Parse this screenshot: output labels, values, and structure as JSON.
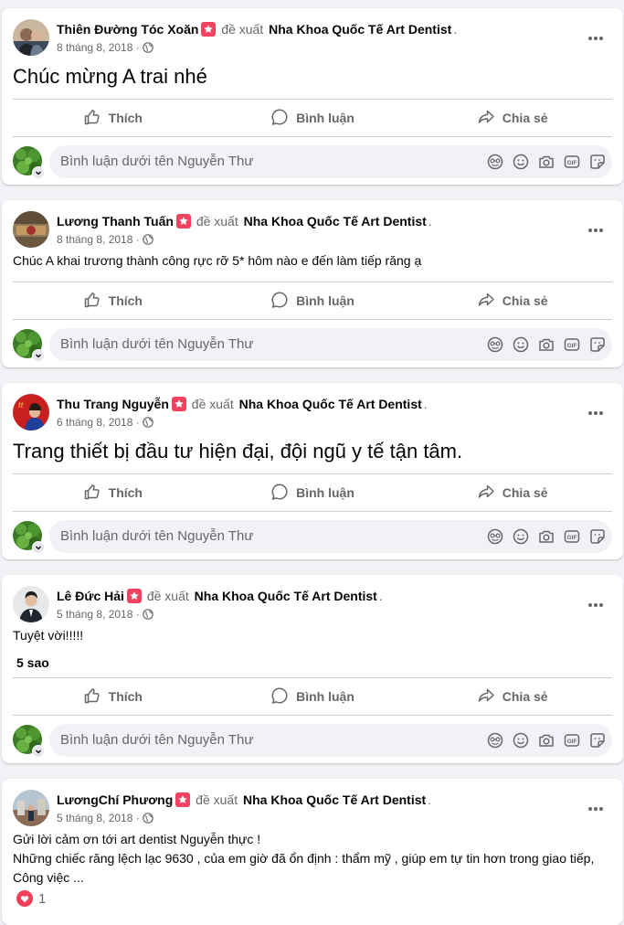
{
  "colors": {
    "accent": "#f3425f",
    "secondary_text": "#65676b",
    "background": "#f0f2f5"
  },
  "comment_placeholder": "Bình luận dưới tên Nguyễn Thư",
  "actions": {
    "like": "Thích",
    "comment": "Bình luận",
    "share": "Chia sẻ"
  },
  "posts": [
    {
      "author": "Thiên Đường Tóc Xoăn",
      "verb": "đề xuất",
      "page": "Nha Khoa Quốc Tế Art Dentist",
      "period": ".",
      "date": "8 tháng 8, 2018",
      "text": "Chúc mừng A trai nhé"
    },
    {
      "author": "Lương Thanh Tuấn",
      "verb": "đề xuất",
      "page": "Nha Khoa Quốc Tế Art Dentist",
      "period": ".",
      "date": "8 tháng 8, 2018",
      "text": "Chúc A khai trương thành công rực rỡ 5* hôm nào e đến làm tiếp răng ạ"
    },
    {
      "author": "Thu Trang Nguyễn",
      "verb": "đề xuất",
      "page": "Nha Khoa Quốc Tế Art Dentist",
      "period": ".",
      "date": "6 tháng 8, 2018",
      "text": "Trang thiết bị đầu tư hiện đại, đội ngũ y tế tận tâm."
    },
    {
      "author": "Lê Đức Hải",
      "verb": "đề xuất",
      "page": "Nha Khoa Quốc Tế Art Dentist",
      "period": ".",
      "date": "5 tháng 8, 2018",
      "text": "Tuyệt vời!!!!!",
      "rating": "5 sao"
    },
    {
      "author": "LươngChí Phương",
      "verb": "đề xuất",
      "page": "Nha Khoa Quốc Tế Art Dentist",
      "period": ".",
      "date": "5 tháng 8, 2018",
      "text": "Gửi lời cảm ơn tới art dentist Nguyễn thực !\nNhững chiếc răng lệch lạc 9630 , của em giờ đã ổn định :  thẩm mỹ , giúp em tự tin hơn trong giao tiếp,\nCông việc ...",
      "reaction_count": "1"
    }
  ]
}
